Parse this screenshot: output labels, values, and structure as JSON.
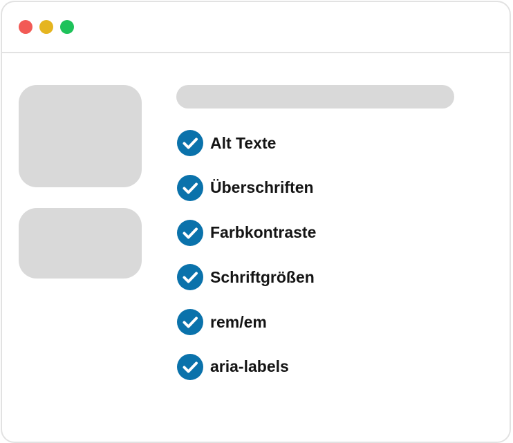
{
  "window": {
    "controls": [
      {
        "name": "close",
        "color": "#f25a55"
      },
      {
        "name": "minimize",
        "color": "#e5b520"
      },
      {
        "name": "maximize",
        "color": "#1ec25a"
      }
    ]
  },
  "colors": {
    "accent": "#0a72ab",
    "placeholder": "#d9d9d9",
    "border": "#e2e2e2"
  },
  "checklist": {
    "icon": "check-circle-icon",
    "items": [
      {
        "label": "Alt Texte",
        "checked": true
      },
      {
        "label": "Überschriften",
        "checked": true
      },
      {
        "label": "Farbkontraste",
        "checked": true
      },
      {
        "label": "Schriftgrößen",
        "checked": true
      },
      {
        "label": "rem/em",
        "checked": true
      },
      {
        "label": "aria-labels",
        "checked": true
      }
    ]
  }
}
